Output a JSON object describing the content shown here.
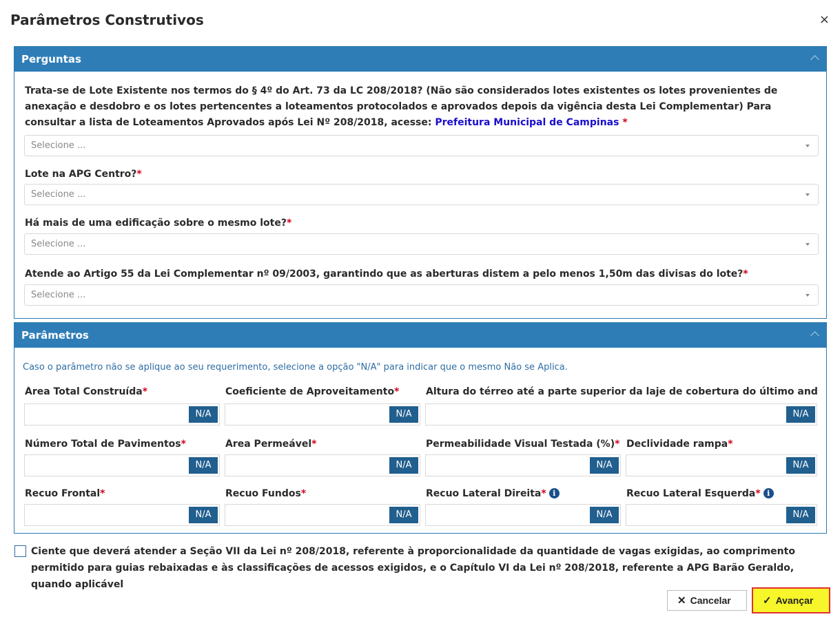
{
  "modal": {
    "title": "Parâmetros Construtivos",
    "close": "×"
  },
  "perguntas": {
    "title": "Perguntas",
    "questions": [
      {
        "label": "Trata-se de Lote Existente nos termos do § 4º do Art. 73 da LC 208/2018? (Não são considerados lotes existentes os lotes provenientes de anexação e desdobro e os lotes pertencentes a loteamentos protocolados e aprovados depois da vigência desta Lei Complementar) Para consultar a lista de Loteamentos Aprovados após Lei Nº 208/2018, acesse: ",
        "link": "Prefeitura Municipal de Campinas",
        "required": " *",
        "placeholder": "Selecione ..."
      },
      {
        "label": "Lote na APG Centro?",
        "required": "*",
        "placeholder": "Selecione ..."
      },
      {
        "label": "Há mais de uma edificação sobre o mesmo lote?",
        "required": "*",
        "placeholder": "Selecione ..."
      },
      {
        "label": "Atende ao Artigo 55 da Lei Complementar nº 09/2003, garantindo que as aberturas distem a pelo menos 1,50m das divisas do lote?",
        "required": "*",
        "placeholder": "Selecione ..."
      }
    ]
  },
  "parametros": {
    "title": "Parâmetros",
    "hint": "Caso o parâmetro não se aplique ao seu requerimento, selecione a opção \"N/A\" para indicar que o mesmo Não se Aplica.",
    "na_label": "N/A",
    "required": "*",
    "info_symbol": "i",
    "fields": [
      {
        "label": "Área Total Construída"
      },
      {
        "label": "Coeficiente de Aproveitamento"
      },
      {
        "label": "Altura do térreo até a parte superior da laje de cobertura do último and"
      },
      {
        "label": "Número Total de Pavimentos"
      },
      {
        "label": "Área Permeável"
      },
      {
        "label": "Permeabilidade Visual Testada (%)"
      },
      {
        "label": "Declividade rampa"
      },
      {
        "label": "Recuo Frontal"
      },
      {
        "label": "Recuo Fundos"
      },
      {
        "label": "Recuo Lateral Direita"
      },
      {
        "label": "Recuo Lateral Esquerda"
      }
    ]
  },
  "agreement": {
    "text": "Ciente que deverá atender a Seção VII da Lei nº 208/2018, referente à proporcionalidade da quantidade de vagas exigidas, ao comprimento permitido para guias rebaixadas e às classificações de acessos exigidos, e o Capítulo VI da Lei nº 208/2018, referente a APG Barão Geraldo, quando aplicável"
  },
  "actions": {
    "cancel": "Cancelar",
    "next": "Avançar"
  }
}
